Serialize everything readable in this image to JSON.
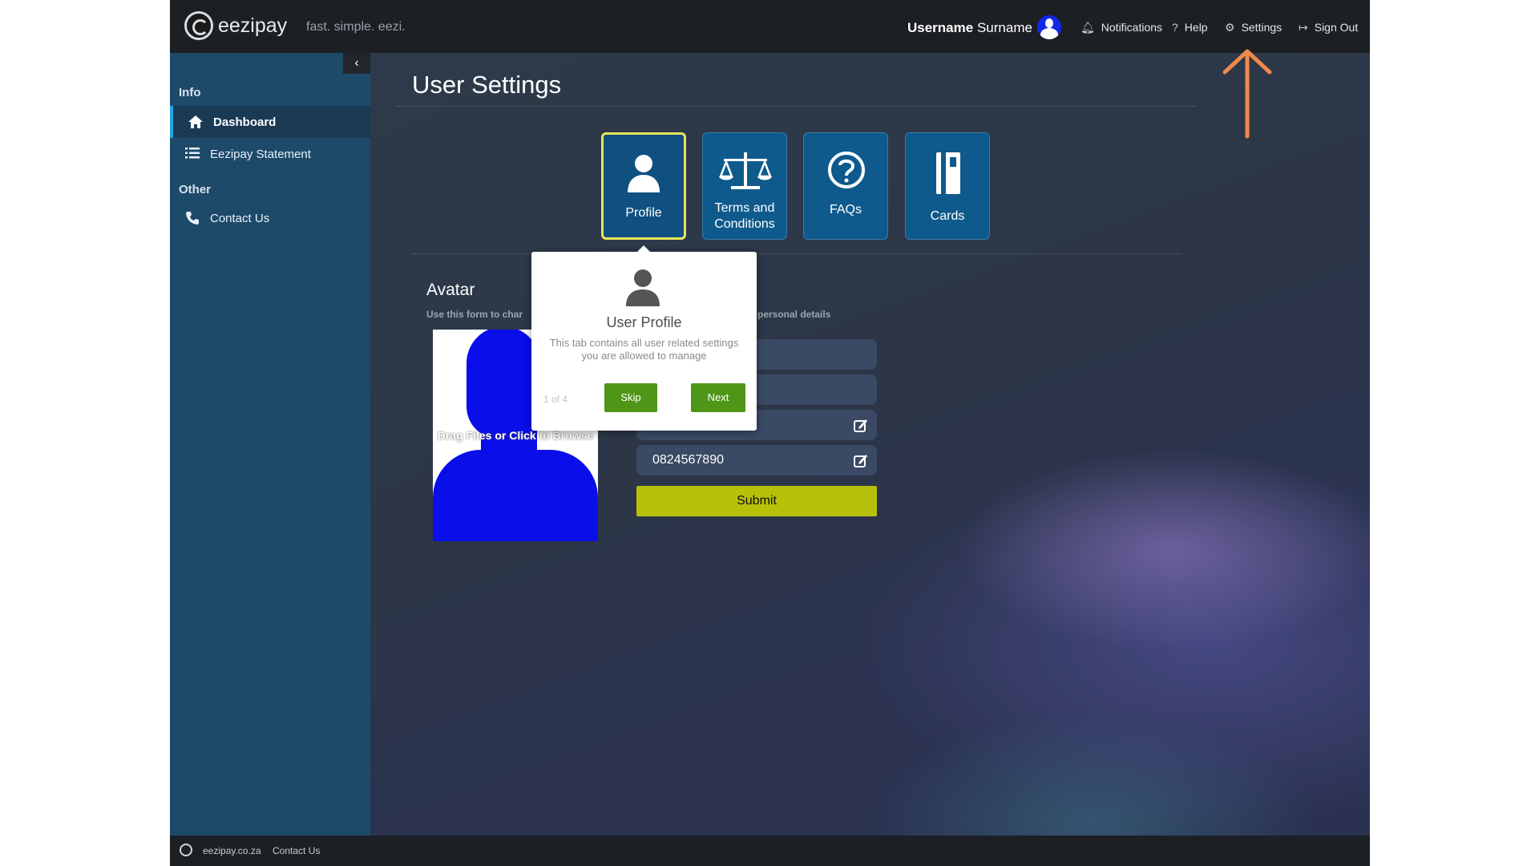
{
  "header": {
    "brand": "eezipay",
    "tagline": "fast. simple. eezi.",
    "user_first": "Username",
    "user_last": "Surname",
    "notifications": "Notifications",
    "help": "Help",
    "settings": "Settings",
    "sign_out": "Sign Out"
  },
  "sidebar": {
    "collapse_icon": "chevron-left-icon",
    "sections": [
      {
        "label": "Info",
        "items": [
          {
            "label": "Dashboard",
            "icon": "home-icon",
            "active": true
          },
          {
            "label": "Eezipay Statement",
            "icon": "list-icon",
            "active": false
          }
        ]
      },
      {
        "label": "Other",
        "items": [
          {
            "label": "Contact Us",
            "icon": "phone-icon",
            "active": false
          }
        ]
      }
    ]
  },
  "main": {
    "title": "User Settings",
    "tabs": [
      {
        "label": "Profile",
        "icon": "user-icon",
        "active": true
      },
      {
        "label_line1": "Terms and",
        "label_line2": "Conditions",
        "icon": "scales-icon",
        "active": false
      },
      {
        "label": "FAQs",
        "icon": "question-circle-icon",
        "active": false
      },
      {
        "label": "Cards",
        "icon": "card-icon",
        "active": false
      }
    ],
    "avatar": {
      "heading": "Avatar",
      "description": "Use this form to char",
      "drop_text": "Drag Files or Click to Browse"
    },
    "details": {
      "description": "r personal details",
      "phone_value": "0824567890",
      "submit_label": "Submit"
    }
  },
  "tour": {
    "title": "User Profile",
    "body": "This tab contains all user related settings you are allowed to manage",
    "step": "1 of 4",
    "skip": "Skip",
    "next": "Next"
  },
  "footer": {
    "site": "eezipay.co.za",
    "contact": "Contact Us"
  },
  "colors": {
    "accent_yellow": "#e8e45a",
    "submit_green": "#b7c10a",
    "tour_green": "#4f9618",
    "sidebar_blue": "#1e4a6a",
    "annotation_orange": "#f08a4b"
  }
}
